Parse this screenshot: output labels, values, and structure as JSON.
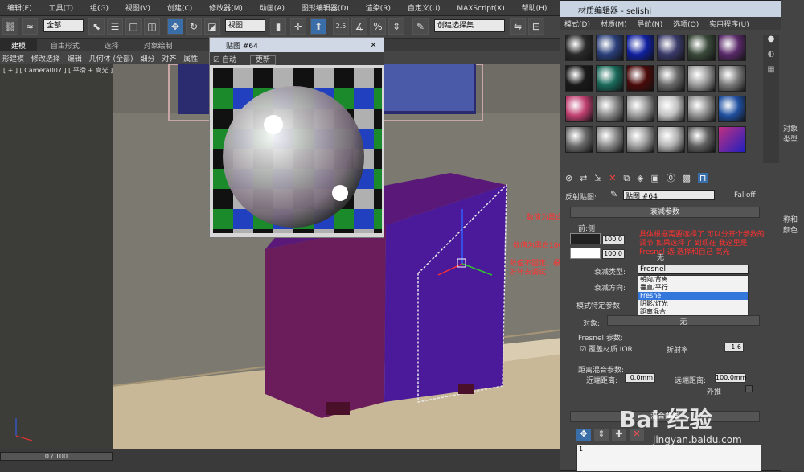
{
  "menu": [
    "编辑(E)",
    "工具(T)",
    "组(G)",
    "视图(V)",
    "创建(C)",
    "修改器(M)",
    "动画(A)",
    "图形编辑器(D)",
    "渲染(R)",
    "自定义(U)",
    "MAXScript(X)",
    "帮助(H)"
  ],
  "toolbar": {
    "filter_value": "全部",
    "view_value": "视图",
    "selection_set": "创建选择集",
    "snap_label": "2.5"
  },
  "ribbon": {
    "tabs": [
      "建模",
      "自由形式",
      "选择",
      "对象绘制"
    ],
    "subs": [
      "形建模",
      "修改选择",
      "编辑",
      "几何体 (全部)",
      "细分",
      "对齐",
      "属性"
    ]
  },
  "viewport": {
    "label": "[ + ] [ Camera007 ] [ 平滑 + 高光 ]"
  },
  "timeline": {
    "frame": "0 / 100"
  },
  "map_window": {
    "title": "贴图 #64",
    "auto_label": "自动",
    "update_label": "更新",
    "close": "×"
  },
  "mat_editor": {
    "title": "材质编辑器 - selishi",
    "menu": [
      "模式(D)",
      "材质(M)",
      "导航(N)",
      "选项(O)",
      "实用程序(U)"
    ],
    "map_label": "反射贴图:",
    "map_name": "贴图 #64",
    "map_type": "Falloff",
    "rollout_falloff": "衰减参数",
    "front_side": "前:侧",
    "val1": "100.0",
    "val2": "100.0",
    "none_label": "无",
    "falloff_type_label": "衰减类型:",
    "falloff_type_value": "Fresnel",
    "falloff_dir_label": "衰减方向:",
    "options": [
      "朝向/背离",
      "垂直/平行",
      "Fresnel",
      "阴影/灯光",
      "距离混合"
    ],
    "mode_params": "模式特定参数:",
    "object_label": "对象:",
    "object_value": "无",
    "fresnel_params": "Fresnel 参数:",
    "override_ior": "覆盖材质 IOR",
    "ior_label": "折射率",
    "ior_value": "1.6",
    "dist_params": "距离混合参数:",
    "near_label": "近端距离:",
    "near_value": "0.0mm",
    "far_label": "远端距离:",
    "far_value": "100.0mm",
    "extrapolate": "外推",
    "curve_rollout": "混合曲线",
    "curve_axis": "1"
  },
  "annotations": {
    "a1": "数值为黑白50",
    "a2": "数值为黑白100",
    "a3": "数值不固定，根据自己的好坏去调试",
    "a4": "具体根据需要选择了 可以分开个参数的调节 如果选择了 到现在 我这里是 Fresnel 选 选择和自己 高光"
  },
  "watermark": {
    "brand": "Bai 经验",
    "url": "jingyan.baidu.com"
  },
  "side": {
    "t1": "对象类型",
    "t2": "称和颜色"
  }
}
